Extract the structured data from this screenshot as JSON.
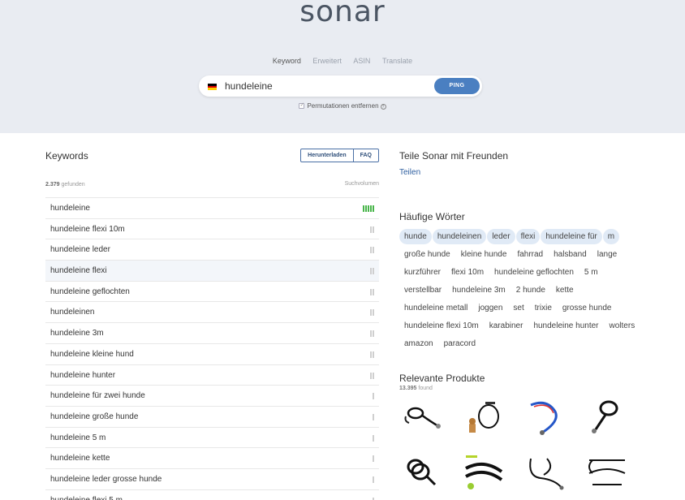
{
  "header": {
    "logo": "sonar",
    "tabs": [
      "Keyword",
      "Erweitert",
      "ASIN",
      "Translate"
    ],
    "active_tab": "Keyword",
    "search": {
      "value": "hundeleine",
      "placeholder": ""
    },
    "ping_label": "PING",
    "permutations_label": "Permutationen entfernen",
    "flag_colors": [
      "#000000",
      "#dd0000",
      "#ffce00"
    ]
  },
  "keywords": {
    "title": "Keywords",
    "download_label": "Herunterladen",
    "faq_label": "FAQ",
    "count": "2.379",
    "count_suffix": "gefunden",
    "volume_header": "Suchvolumen",
    "rows": [
      {
        "text": "hundeleine",
        "bars": 5,
        "color": "green"
      },
      {
        "text": "hundeleine flexi 10m",
        "bars": 2,
        "color": "gray"
      },
      {
        "text": "hundeleine leder",
        "bars": 2,
        "color": "gray"
      },
      {
        "text": "hundeleine flexi",
        "bars": 2,
        "color": "gray"
      },
      {
        "text": "hundeleine geflochten",
        "bars": 2,
        "color": "gray"
      },
      {
        "text": "hundeleinen",
        "bars": 2,
        "color": "gray"
      },
      {
        "text": "hundeleine 3m",
        "bars": 2,
        "color": "gray"
      },
      {
        "text": "hundeleine kleine hund",
        "bars": 2,
        "color": "gray"
      },
      {
        "text": "hundeleine hunter",
        "bars": 2,
        "color": "gray"
      },
      {
        "text": "hundeleine für zwei hunde",
        "bars": 1,
        "color": "gray"
      },
      {
        "text": "hundeleine große hunde",
        "bars": 1,
        "color": "gray"
      },
      {
        "text": "hundeleine 5 m",
        "bars": 1,
        "color": "gray"
      },
      {
        "text": "hundeleine kette",
        "bars": 1,
        "color": "gray"
      },
      {
        "text": "hundeleine leder grosse hunde",
        "bars": 1,
        "color": "gray"
      },
      {
        "text": "hundeleine flexi 5 m",
        "bars": 1,
        "color": "gray"
      }
    ]
  },
  "share": {
    "title": "Teile Sonar mit Freunden",
    "link": "Teilen"
  },
  "words": {
    "title": "Häufige Wörter",
    "tags": [
      "hunde",
      "hundeleinen",
      "leder",
      "flexi",
      "hundeleine für",
      "m",
      "große hunde",
      "kleine hunde",
      "fahrrad",
      "halsband",
      "lange",
      "kurzführer",
      "flexi 10m",
      "hundeleine geflochten",
      "5 m",
      "verstellbar",
      "hundeleine 3m",
      "2 hunde",
      "kette",
      "hundeleine metall",
      "joggen",
      "set",
      "trixie",
      "grosse hunde",
      "hundeleine flexi 10m",
      "karabiner",
      "hundeleine hunter",
      "wolters",
      "amazon",
      "paracord"
    ],
    "highlighted_count": 6
  },
  "products": {
    "title": "Relevante Produkte",
    "count": "13.395",
    "count_suffix": "found",
    "items": [
      "black-coiled-leash",
      "leash-with-dog",
      "blue-red-leash",
      "black-loop-leash",
      "black-tracking-line",
      "neon-green-trim-leash",
      "black-double-leash",
      "black-rope-leash"
    ]
  }
}
